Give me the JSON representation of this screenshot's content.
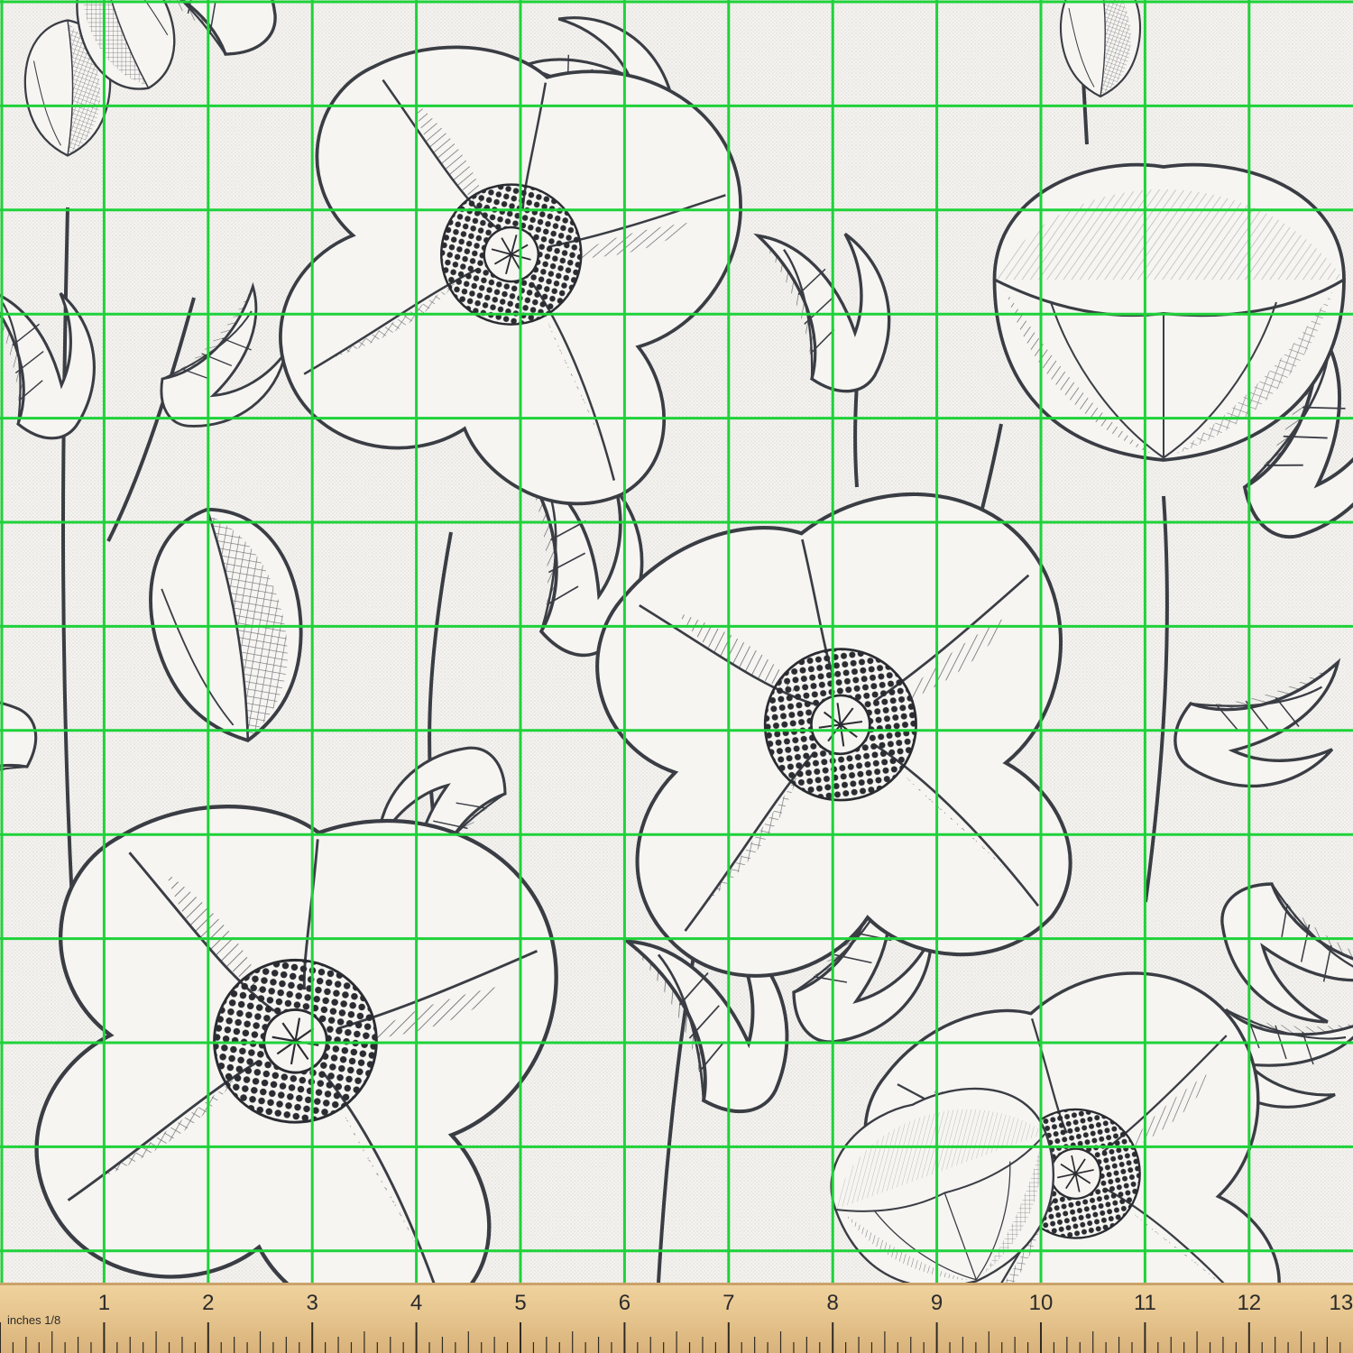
{
  "fabric": {
    "colors": {
      "background": "#f3f2ef",
      "ink": "#3a3d44",
      "ink_dark": "#2a2c31",
      "grid": "#1fd23a"
    },
    "grid": {
      "columns": 13,
      "rows": 12
    },
    "motif_names": [
      "poppy-bud-icon",
      "poppy-flower-icon",
      "poppy-leaf-icon"
    ]
  },
  "ruler": {
    "unit_label": "inches 1/8",
    "numbers": [
      "1",
      "2",
      "3",
      "4",
      "5",
      "6",
      "7",
      "8",
      "9",
      "10",
      "11",
      "12",
      "13"
    ],
    "subdivisions": 8,
    "colors": {
      "wood": "#e6c48d",
      "wood_edge": "#caa36a",
      "tick": "#2f2a22",
      "text": "#2b2b2b"
    }
  }
}
